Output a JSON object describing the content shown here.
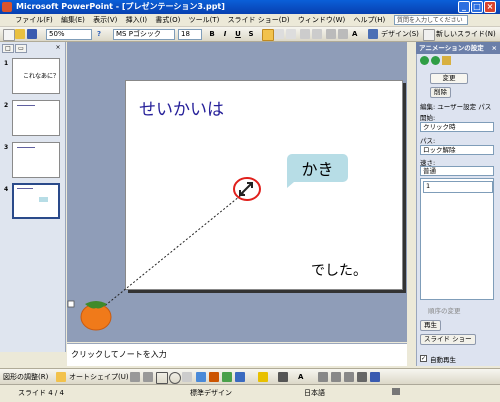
{
  "window": {
    "title": "Microsoft PowerPoint - [プレゼンテーション3.ppt]"
  },
  "menu": [
    "ファイル(F)",
    "編集(E)",
    "表示(V)",
    "挿入(I)",
    "書式(O)",
    "ツール(T)",
    "スライド ショー(D)",
    "ウィンドウ(W)",
    "ヘルプ(H)"
  ],
  "help_search": {
    "placeholder": "質問を入力してください"
  },
  "toolbar": {
    "zoom": "50%",
    "font": "MS Pゴシック",
    "size": "18",
    "bold": "B",
    "italic": "I",
    "underline": "U",
    "shadow": "S",
    "design_label": "デザイン(S)",
    "new_slide_label": "新しいスライド(N)"
  },
  "slides_pane": {
    "slides": [
      {
        "number": "1",
        "text": "これなあに？"
      },
      {
        "number": "2",
        "text": ""
      },
      {
        "number": "3",
        "text": ""
      },
      {
        "number": "4",
        "text": ""
      }
    ]
  },
  "slide": {
    "title": "せいかいは",
    "callout": "かき",
    "bottom_text": "でした。"
  },
  "notes": {
    "placeholder": "クリックしてノートを入力"
  },
  "task_pane": {
    "title": "アニメーションの設定",
    "change_label": "変更",
    "delete_label": "削除",
    "edit_label": "編集: ユーザー設定 パス",
    "start_label": "開始:",
    "start_value": "クリック時",
    "path_label": "パス:",
    "path_value": "ロック解除",
    "speed_label": "速さ:",
    "speed_value": "普通",
    "list_item_number": "1",
    "reorder_label": "順序の変更",
    "play_label": "再生",
    "slideshow_label": "スライド ショー",
    "autopreview_label": "自動再生"
  },
  "drawing_toolbar": {
    "draw_label": "図形の調整(R)",
    "autoshape_label": "オートシェイプ(U)"
  },
  "status": {
    "slide": "スライド 4 / 4",
    "design": "標準デザイン",
    "language": "日本語"
  },
  "colors": {
    "title_bar": "#0a5fd8",
    "slide_title": "#27219a",
    "callout_fill": "#b7dde6",
    "highlight_circle": "#e0201c",
    "persimmon": "#f07a1a"
  }
}
